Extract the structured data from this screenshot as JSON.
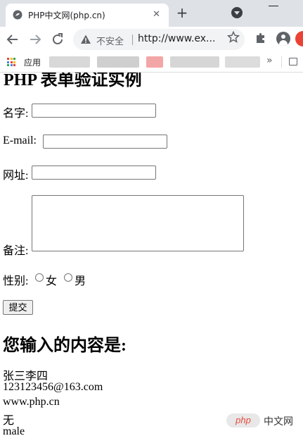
{
  "browser": {
    "tab_title": "PHP中文网(php.cn)",
    "tab_close": "✕",
    "new_tab": "+",
    "address": {
      "security_label": "不安全",
      "url": "http://www.ex..."
    },
    "bookmarks": {
      "apps_label": "应用",
      "overflow": "»"
    },
    "icons": [
      "php-favicon",
      "close-icon",
      "plus-icon",
      "tab-search-icon",
      "minimize-icon",
      "back-icon",
      "forward-icon",
      "reload-icon",
      "warning-icon",
      "star-icon",
      "extensions-icon",
      "profile-icon",
      "apps-grid-icon",
      "reading-list-icon"
    ]
  },
  "page": {
    "heading": "PHP 表单验证实例",
    "form": {
      "name_label": "名字:",
      "email_label": "E-mail:",
      "website_label": "网址:",
      "comment_label": "备注:",
      "gender_label": "性别:",
      "gender_options": [
        "女",
        "男"
      ],
      "submit_label": "提交"
    },
    "result": {
      "heading": "您输入的内容是:",
      "lines": [
        "张三李四",
        "123123456@163.com",
        "www.php.cn",
        "无",
        "male"
      ]
    }
  },
  "watermark": {
    "badge": "php",
    "text": "中文网"
  },
  "colors": {
    "tabstrip": "#dee1e6",
    "omnibox": "#f1f3f4",
    "watermark_red": "#e74c3c"
  }
}
